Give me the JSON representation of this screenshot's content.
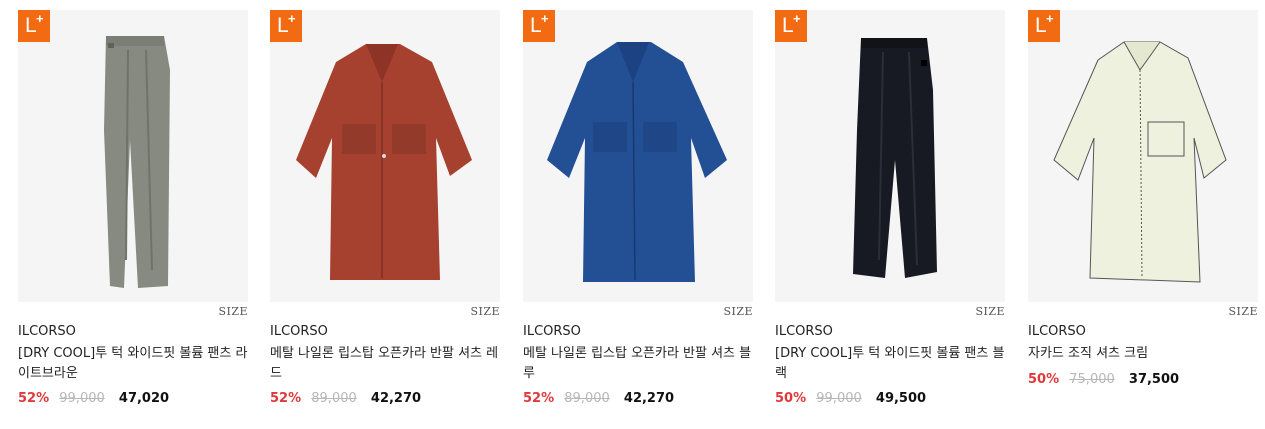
{
  "products": [
    {
      "badge": {
        "letter": "L",
        "plus": "+",
        "color": "#f26b12"
      },
      "size_label": "SIZE",
      "brand": "ILCORSO",
      "name": "[DRY COOL]투 턱 와이드핏 볼륨 팬츠 라이트브라운",
      "discount_rate": "52%",
      "original_price": "99,000",
      "sale_price": "47,020",
      "image": {
        "kind": "wide-pants",
        "color": "#868a80"
      }
    },
    {
      "badge": {
        "letter": "L",
        "plus": "+",
        "color": "#f26b12"
      },
      "size_label": "SIZE",
      "brand": "ILCORSO",
      "name": "메탈 나일론 립스탑 오픈카라 반팔 셔츠 레드",
      "discount_rate": "52%",
      "original_price": "89,000",
      "sale_price": "42,270",
      "image": {
        "kind": "open-collar-shirt",
        "color": "#a6402f"
      }
    },
    {
      "badge": {
        "letter": "L",
        "plus": "+",
        "color": "#f26b12"
      },
      "size_label": "SIZE",
      "brand": "ILCORSO",
      "name": "메탈 나일론 립스탑 오픈카라 반팔 셔츠 블루",
      "discount_rate": "52%",
      "original_price": "89,000",
      "sale_price": "42,270",
      "image": {
        "kind": "open-collar-shirt",
        "color": "#234f95"
      }
    },
    {
      "badge": {
        "letter": "L",
        "plus": "+",
        "color": "#f26b12"
      },
      "size_label": "SIZE",
      "brand": "ILCORSO",
      "name": "[DRY COOL]투 턱 와이드핏 볼륨 팬츠 블랙",
      "discount_rate": "50%",
      "original_price": "99,000",
      "sale_price": "49,500",
      "image": {
        "kind": "wide-pants",
        "color": "#171a22"
      }
    },
    {
      "badge": {
        "letter": "L",
        "plus": "+",
        "color": "#f26b12"
      },
      "size_label": "SIZE",
      "brand": "ILCORSO",
      "name": "자카드 조직 셔츠 크림",
      "discount_rate": "50%",
      "original_price": "75,000",
      "sale_price": "37,500",
      "image": {
        "kind": "collar-shirt",
        "color": "#eef1de"
      }
    }
  ]
}
